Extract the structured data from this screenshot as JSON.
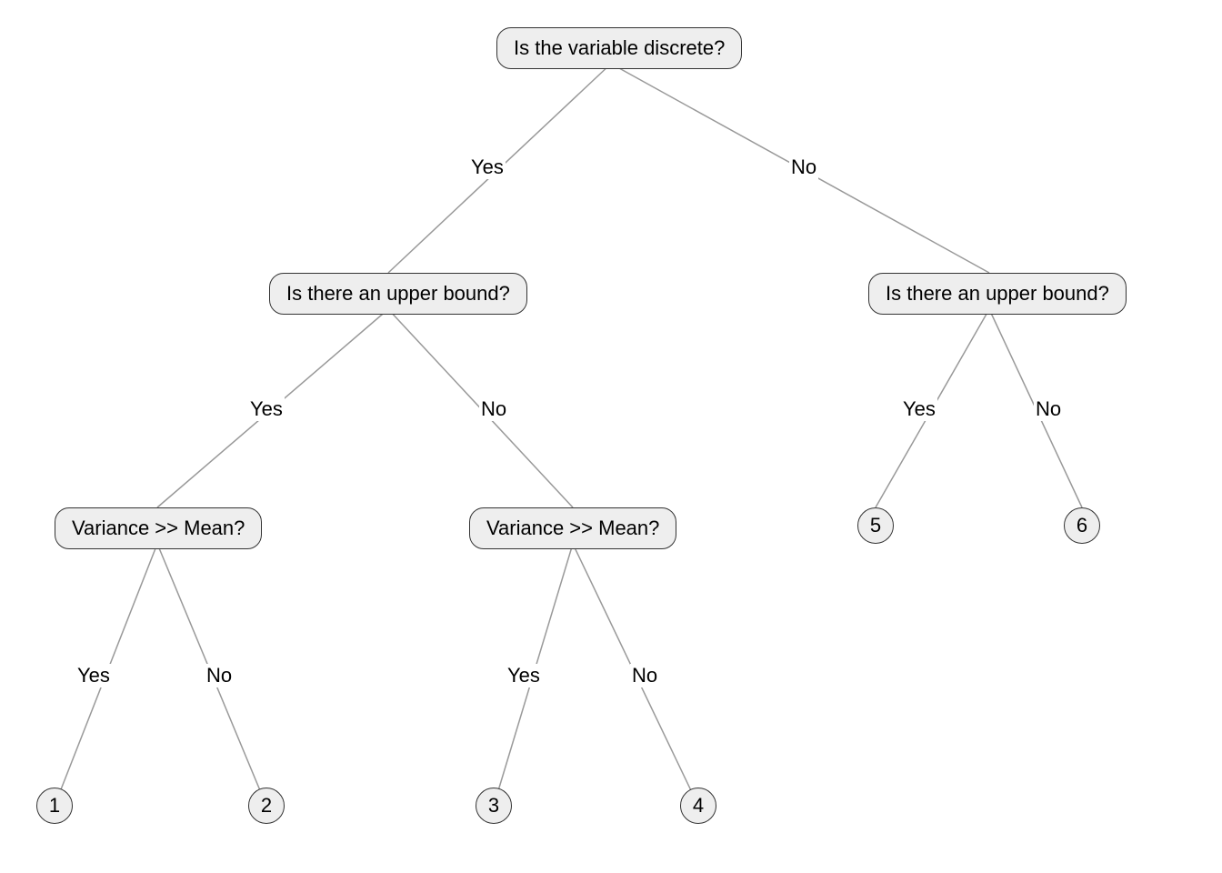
{
  "nodes": {
    "root": "Is the variable discrete?",
    "left": "Is there an upper bound?",
    "right": "Is there an upper bound?",
    "varleft": "Variance >> Mean?",
    "varright": "Variance >> Mean?",
    "leaf1": "1",
    "leaf2": "2",
    "leaf3": "3",
    "leaf4": "4",
    "leaf5": "5",
    "leaf6": "6"
  },
  "labels": {
    "yes": "Yes",
    "no": "No"
  }
}
